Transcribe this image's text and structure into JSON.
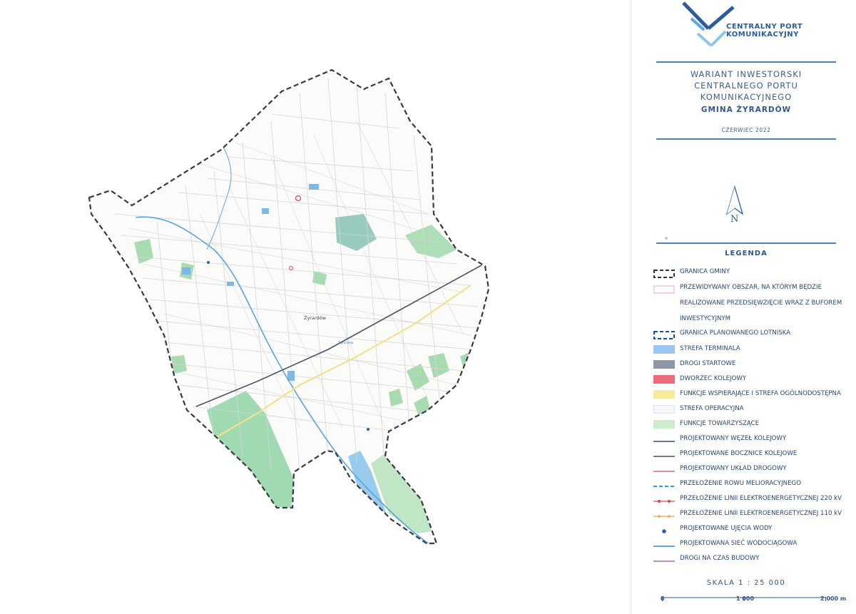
{
  "logo": {
    "line1": "CENTRALNY PORT",
    "line2": "KOMUNIKACYJNY",
    "icon": "cpk-logo-icon",
    "color": "#2d5c9c"
  },
  "header": {
    "title_lines": [
      "WARIANT INWESTORSKI",
      "CENTRALNEGO PORTU",
      "KOMUNIKACYJNEGO"
    ],
    "subtitle": "GMINA ŻYRARDÓW",
    "date": "CZERWIEC 2022"
  },
  "north": {
    "label": "N",
    "icon": "north-arrow-icon"
  },
  "map": {
    "place_label": "Żyrardów",
    "station_label": "Żyrardów"
  },
  "legend": {
    "title": "LEGENDA",
    "items": [
      {
        "label": "GRANICA GMINY",
        "symbol": "dashed-black-box",
        "color": "#333333"
      },
      {
        "label": "PRZEWIDYWANY OBSZAR, NA KTÓRYM BĘDZIE",
        "symbol": "outline-pink",
        "color": "#e7a9c7"
      },
      {
        "label": "REALIZOWANE PRZEDSIĘWZIĘCIE WRAZ Z BUFOREM",
        "symbol": "none"
      },
      {
        "label": "INWESTYCYJNYM",
        "symbol": "none"
      },
      {
        "label": "GRANICA PLANOWANEGO LOTNISKA",
        "symbol": "dashed-blue-box",
        "color": "#1d4f9c"
      },
      {
        "label": "STREFA TERMINALA",
        "symbol": "fill",
        "color": "#9cc6ef"
      },
      {
        "label": "DROGI STARTOWE",
        "symbol": "fill",
        "color": "#8f97a6"
      },
      {
        "label": "DWORZEC KOLEJOWY",
        "symbol": "fill",
        "color": "#ee6a78"
      },
      {
        "label": "FUNKCJE WSPIERAJĄCE I STREFA OGÓLNODOSTĘPNA",
        "symbol": "fill",
        "color": "#f6ea9c"
      },
      {
        "label": "STREFA OPERACYJNA",
        "symbol": "fill",
        "color": "#f6f6f6"
      },
      {
        "label": "FUNKCJE TOWARZYSZĄCE",
        "symbol": "fill",
        "color": "#cdeccb"
      },
      {
        "label": "PROJEKTOWANY WĘZEŁ KOLEJOWY",
        "symbol": "line",
        "color": "#3c4a7c"
      },
      {
        "label": "PROJEKTOWANE BOCZNICE KOLEJOWE",
        "symbol": "line",
        "color": "#4a4f5a"
      },
      {
        "label": "PROJEKTOWANY UKŁAD DROGOWY",
        "symbol": "line",
        "color": "#c46aa6"
      },
      {
        "label": "PRZEŁOŻENIE ROWU MELIORACYJNEGO",
        "symbol": "dashed-line",
        "color": "#3a9ad8"
      },
      {
        "label": "PRZEŁOŻENIE LINII ELEKTROENERGETYCZNEJ 220 kV",
        "symbol": "line-dots",
        "color": "#d9454f"
      },
      {
        "label": "PRZEŁOŻENIE LINII ELEKTROENERGETYCZNEJ 110 kV",
        "symbol": "line-dots",
        "color": "#e7a64a"
      },
      {
        "label": "PROJEKTOWANE UJĘCIA WODY",
        "symbol": "dot",
        "color": "#2b5fb0"
      },
      {
        "label": "PROJEKTOWANA SIEĆ WODOCIĄGOWA",
        "symbol": "line",
        "color": "#2c8fd1"
      },
      {
        "label": "DROGI NA CZAS BUDOWY",
        "symbol": "line",
        "color": "#9b6ab8"
      }
    ]
  },
  "scale": {
    "label": "SKALA 1 : 25 000",
    "ticks": [
      "0",
      "1 000",
      "2 000 m"
    ]
  }
}
